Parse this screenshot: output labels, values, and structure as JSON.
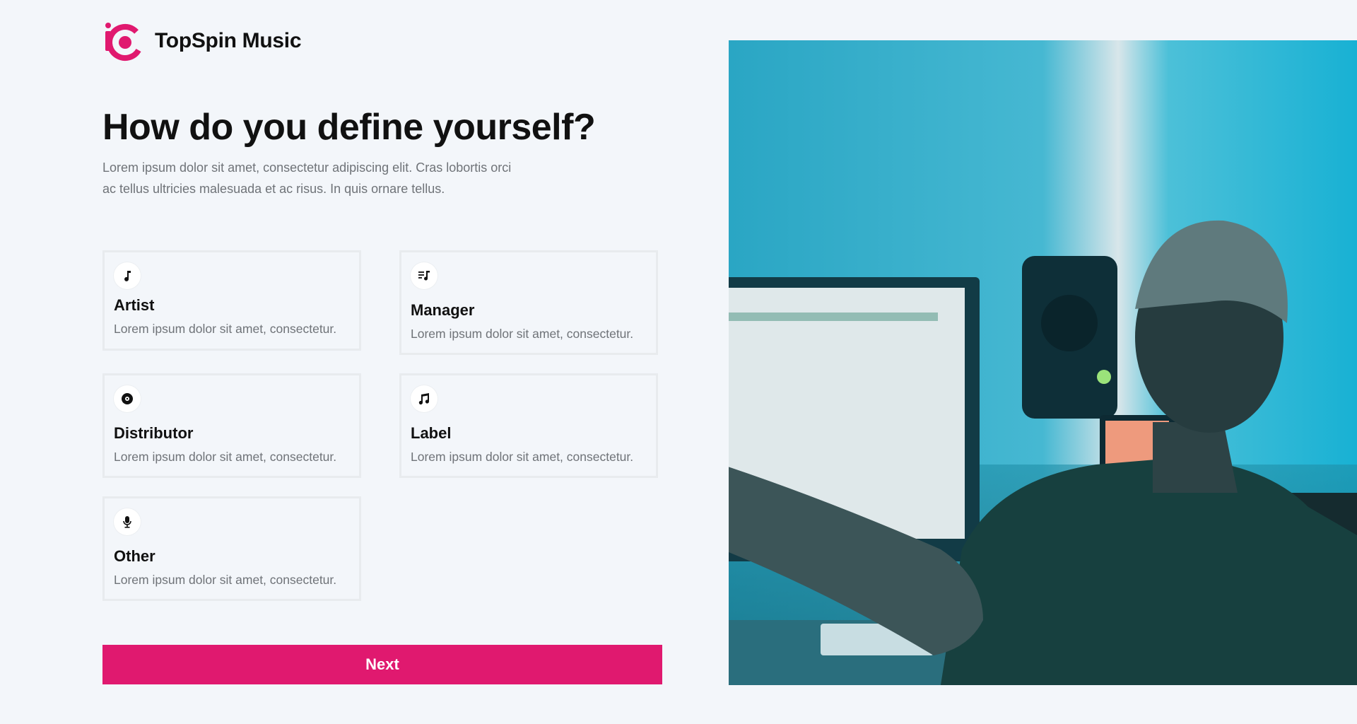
{
  "brand": {
    "name": "TopSpin Music",
    "accent_color": "#e0196f"
  },
  "heading": {
    "title": "How do you define yourself?",
    "subtitle": "Lorem ipsum dolor sit amet, consectetur adipiscing elit. Cras lobortis orci ac tellus ultricies malesuada et ac risus. In quis ornare tellus."
  },
  "options": [
    {
      "icon": "music-note-icon",
      "label": "Artist",
      "description": "Lorem ipsum dolor sit amet, consectetur."
    },
    {
      "icon": "playlist-icon",
      "label": "Manager",
      "description": "Lorem ipsum dolor sit amet, consectetur."
    },
    {
      "icon": "vinyl-disc-icon",
      "label": "Distributor",
      "description": "Lorem ipsum dolor sit amet, consectetur."
    },
    {
      "icon": "music-notes-icon",
      "label": "Label",
      "description": "Lorem ipsum dolor sit amet, consectetur."
    },
    {
      "icon": "microphone-icon",
      "label": "Other",
      "description": "Lorem ipsum dolor sit amet, consectetur."
    }
  ],
  "actions": {
    "next_label": "Next"
  },
  "hero_image": {
    "subject": "person-at-music-studio-computer-photo"
  }
}
